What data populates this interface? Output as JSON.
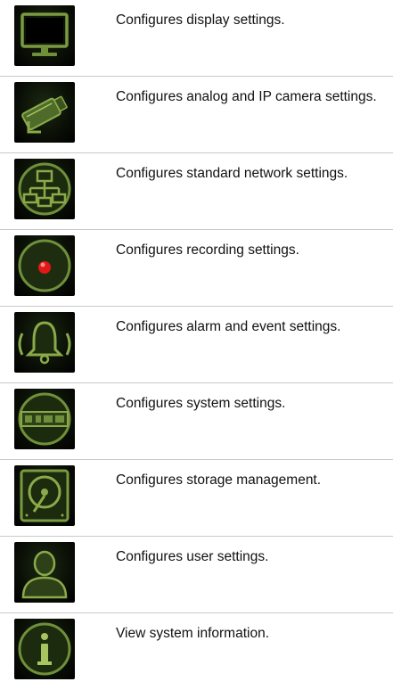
{
  "rows": [
    {
      "icon": "display-monitor-icon",
      "description": "Configures display settings."
    },
    {
      "icon": "camera-icon",
      "description": "Configures analog and IP camera settings."
    },
    {
      "icon": "network-icon",
      "description": "Configures standard network settings."
    },
    {
      "icon": "record-icon",
      "description": "Configures recording settings."
    },
    {
      "icon": "alarm-bell-icon",
      "description": "Configures alarm and event settings."
    },
    {
      "icon": "system-device-icon",
      "description": "Configures system settings."
    },
    {
      "icon": "hard-disk-icon",
      "description": "Configures storage management."
    },
    {
      "icon": "user-icon",
      "description": "Configures user settings."
    },
    {
      "icon": "info-icon",
      "description": "View system information."
    }
  ],
  "colors": {
    "icon_green": "#6f8f3a",
    "icon_bg": "#000000",
    "record_red": "#e01818",
    "divider": "#c9c9c9"
  }
}
